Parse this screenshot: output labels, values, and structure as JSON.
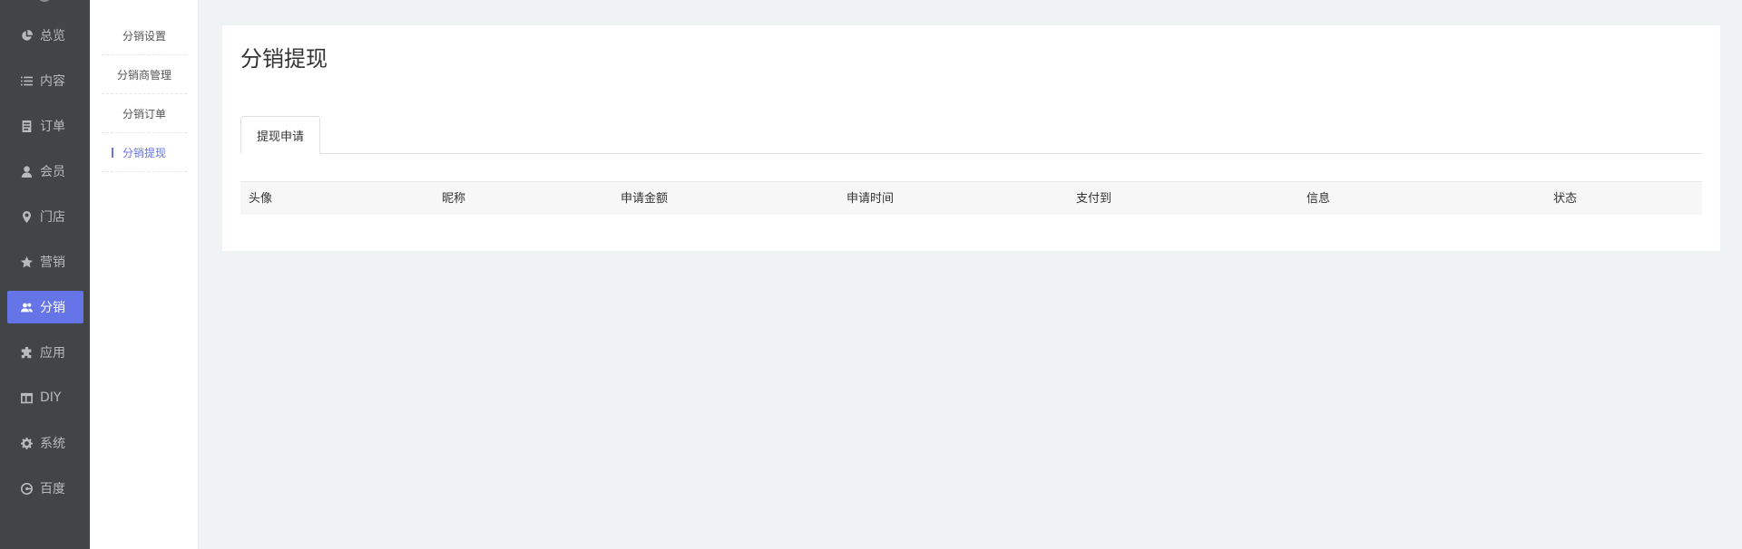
{
  "nav": {
    "items": [
      {
        "label": "总览",
        "icon": "pie-chart-icon"
      },
      {
        "label": "内容",
        "icon": "list-icon"
      },
      {
        "label": "订单",
        "icon": "document-icon"
      },
      {
        "label": "会员",
        "icon": "user-icon"
      },
      {
        "label": "门店",
        "icon": "location-pin-icon"
      },
      {
        "label": "营销",
        "icon": "star-icon"
      },
      {
        "label": "分销",
        "icon": "users-icon",
        "active": true
      },
      {
        "label": "应用",
        "icon": "puzzle-icon"
      },
      {
        "label": "DIY",
        "icon": "layout-icon"
      },
      {
        "label": "系统",
        "icon": "gear-icon"
      },
      {
        "label": "百度",
        "icon": "baidu-icon"
      }
    ]
  },
  "subnav": {
    "items": [
      {
        "label": "分销设置"
      },
      {
        "label": "分销商管理"
      },
      {
        "label": "分销订单"
      },
      {
        "label": "分销提现",
        "active": true
      }
    ]
  },
  "main": {
    "title": "分销提现",
    "tabs": [
      {
        "label": "提现申请",
        "active": true
      }
    ],
    "table": {
      "columns": [
        "头像",
        "昵称",
        "申请金额",
        "申请时间",
        "支付到",
        "信息",
        "状态"
      ]
    }
  },
  "colors": {
    "nav_bg": "#424548",
    "accent": "#6574e6",
    "page_bg": "#eff3f3"
  }
}
